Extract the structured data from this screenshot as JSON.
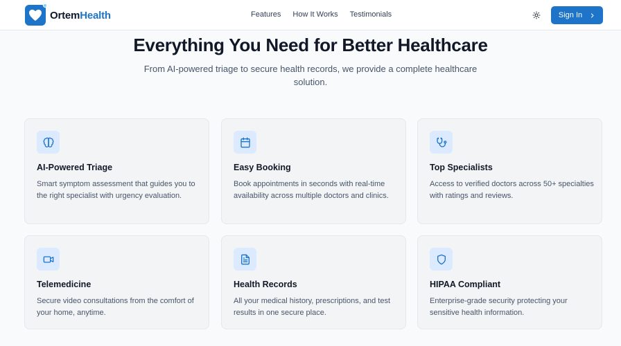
{
  "brand": {
    "name_part1": "Ortem",
    "name_part2": "Health"
  },
  "nav": {
    "links": [
      "Features",
      "How It Works",
      "Testimonials"
    ]
  },
  "header": {
    "signin_label": "Sign In"
  },
  "hero": {
    "title": "Everything You Need for Better Healthcare",
    "subtitle": "From AI-powered triage to secure health records, we provide a complete healthcare solution."
  },
  "features": [
    {
      "icon": "brain-icon",
      "title": "AI-Powered Triage",
      "description": "Smart symptom assessment that guides you to the right specialist with urgency evaluation."
    },
    {
      "icon": "calendar-icon",
      "title": "Easy Booking",
      "description": "Book appointments in seconds with real-time availability across multiple doctors and clinics."
    },
    {
      "icon": "stethoscope-icon",
      "title": "Top Specialists",
      "description": "Access to verified doctors across 50+ specialties with ratings and reviews."
    },
    {
      "icon": "video-icon",
      "title": "Telemedicine",
      "description": "Secure video consultations from the comfort of your home, anytime."
    },
    {
      "icon": "file-text-icon",
      "title": "Health Records",
      "description": "All your medical history, prescriptions, and test results in one secure place."
    },
    {
      "icon": "shield-icon",
      "title": "HIPAA Compliant",
      "description": "Enterprise-grade security protecting your sensitive health information."
    }
  ],
  "colors": {
    "accent": "#1d74c9",
    "icon_bg": "#dbeafe",
    "card_bg": "#f3f4f6",
    "page_bg": "#f8fafc"
  }
}
